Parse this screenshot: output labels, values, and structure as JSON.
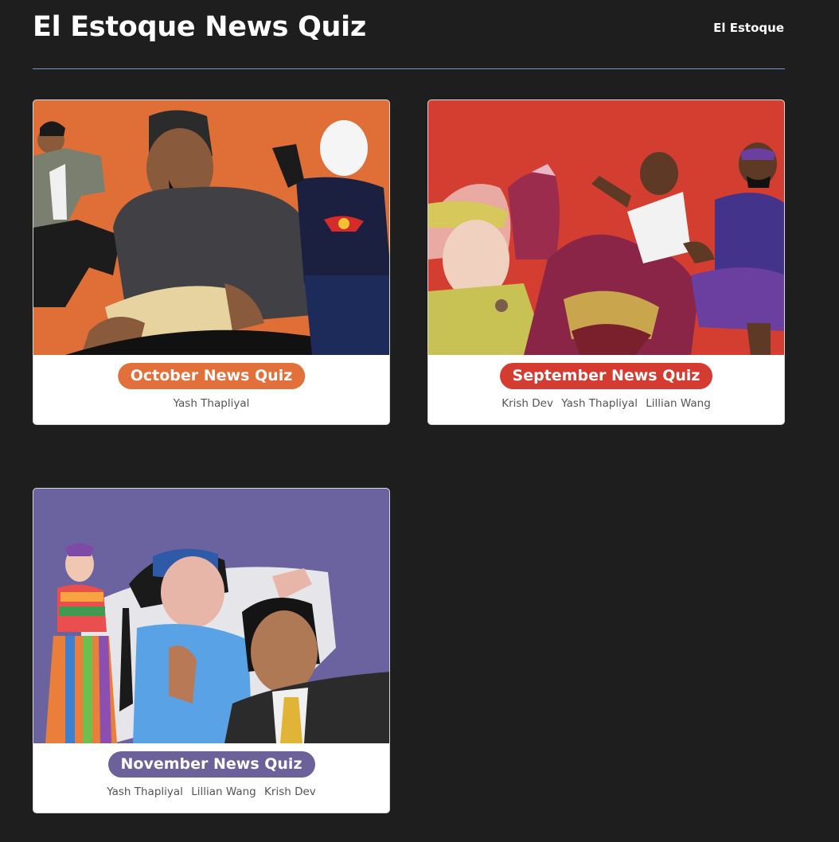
{
  "header": {
    "title": "El Estoque News Quiz",
    "site_link": "El Estoque",
    "divider_color": "#6e97d4"
  },
  "cards": [
    {
      "title": "October News Quiz",
      "accent": "#e2703a",
      "art_bg": "#e06f37",
      "authors": [
        "Yash Thapliyal"
      ]
    },
    {
      "title": "September News Quiz",
      "accent": "#d43c32",
      "art_bg": "#d33e30",
      "authors": [
        "Krish Dev",
        "Yash Thapliyal",
        "Lillian Wang"
      ]
    },
    {
      "title": "November News Quiz",
      "accent": "#6c6299",
      "art_bg": "#6b63a0",
      "authors": [
        "Yash Thapliyal",
        "Lillian Wang",
        "Krish Dev"
      ]
    }
  ]
}
